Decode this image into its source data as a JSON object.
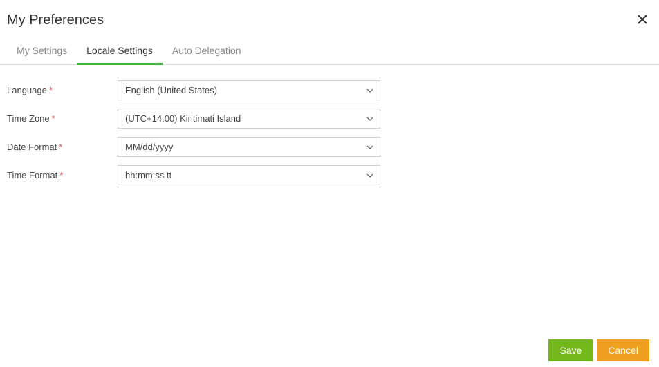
{
  "header": {
    "title": "My Preferences"
  },
  "tabs": [
    {
      "label": "My Settings",
      "active": false
    },
    {
      "label": "Locale Settings",
      "active": true
    },
    {
      "label": "Auto Delegation",
      "active": false
    }
  ],
  "form": {
    "language": {
      "label": "Language",
      "required": true,
      "value": "English (United States)"
    },
    "timezone": {
      "label": "Time Zone",
      "required": true,
      "value": "(UTC+14:00) Kiritimati Island"
    },
    "dateformat": {
      "label": "Date Format",
      "required": true,
      "value": "MM/dd/yyyy"
    },
    "timeformat": {
      "label": "Time Format",
      "required": true,
      "value": "hh:mm:ss tt"
    }
  },
  "footer": {
    "save_label": "Save",
    "cancel_label": "Cancel"
  }
}
